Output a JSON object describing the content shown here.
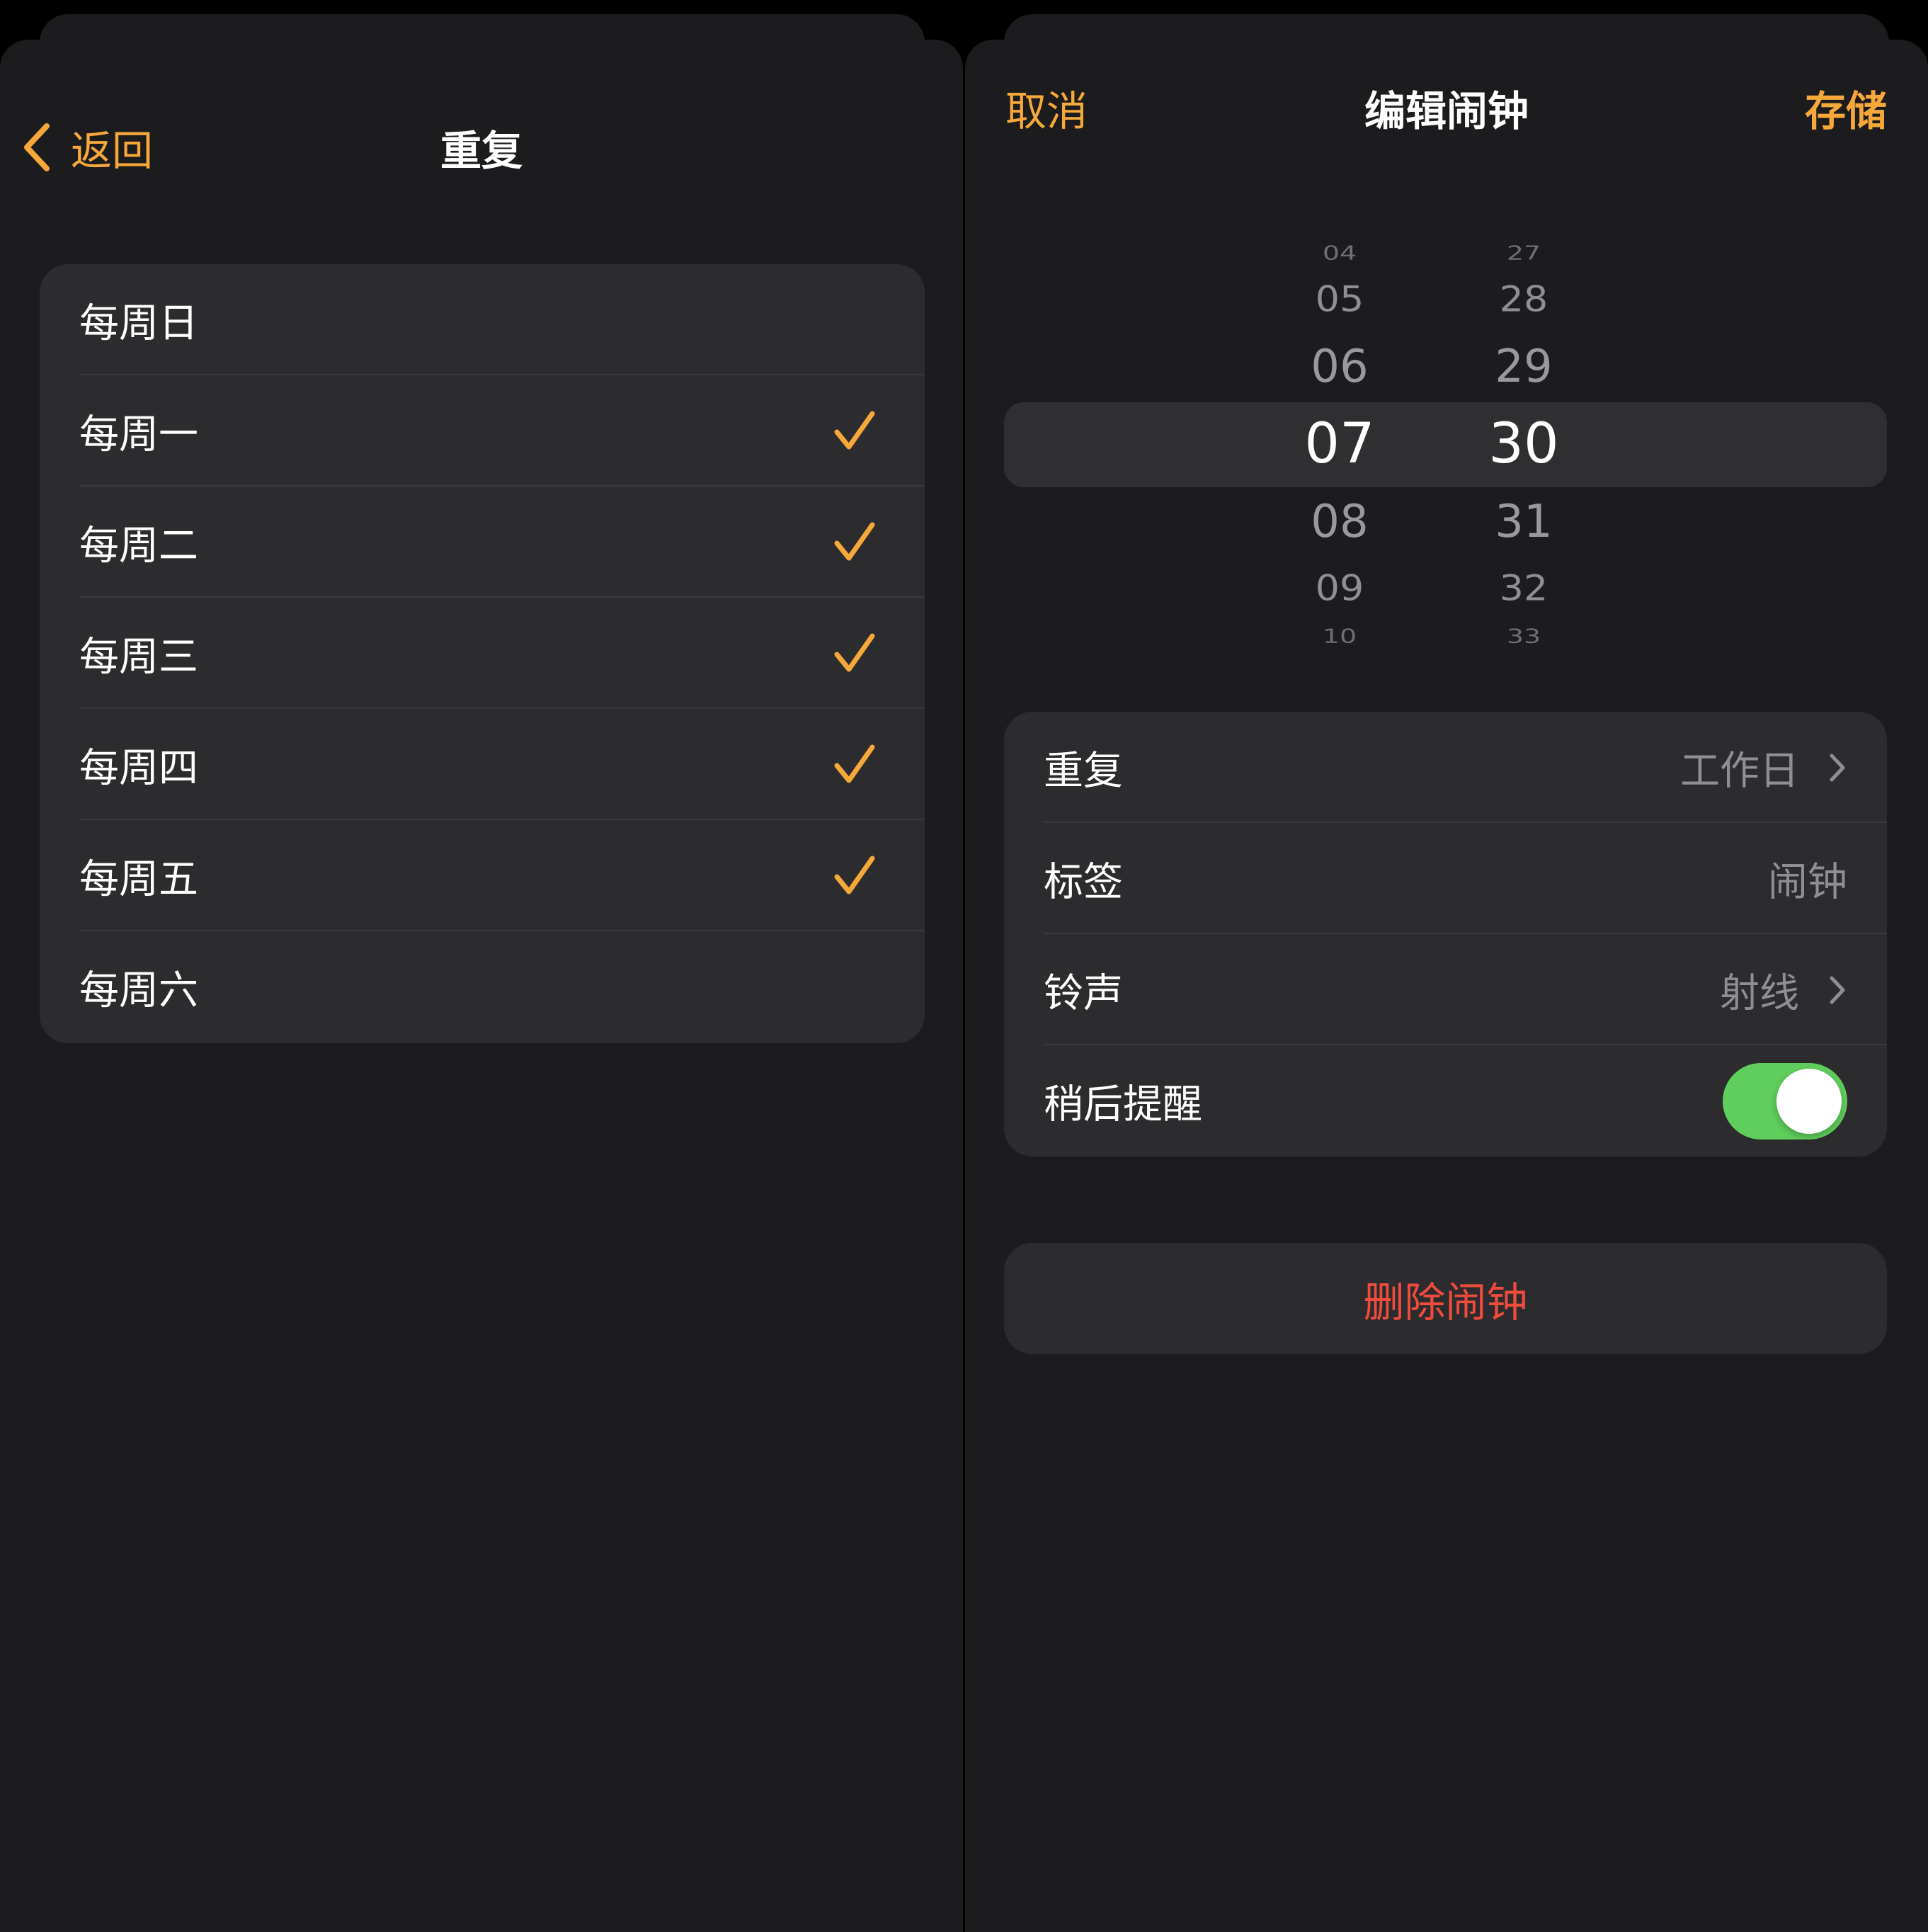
{
  "colors": {
    "accent": "#f6a83b",
    "destructive": "#f04b3c",
    "toggle_on": "#5fce5c",
    "secondary_text": "#8e8e93"
  },
  "left_panel": {
    "back_label": "返回",
    "title": "重复",
    "days": [
      {
        "label": "每周日",
        "checked": false
      },
      {
        "label": "每周一",
        "checked": true
      },
      {
        "label": "每周二",
        "checked": true
      },
      {
        "label": "每周三",
        "checked": true
      },
      {
        "label": "每周四",
        "checked": true
      },
      {
        "label": "每周五",
        "checked": true
      },
      {
        "label": "每周六",
        "checked": false
      }
    ]
  },
  "right_panel": {
    "cancel_label": "取消",
    "title": "编辑闹钟",
    "save_label": "存储",
    "picker": {
      "hours": [
        "04",
        "05",
        "06",
        "07",
        "08",
        "09",
        "10"
      ],
      "minutes": [
        "27",
        "28",
        "29",
        "30",
        "31",
        "32",
        "33"
      ],
      "selected_hour": "07",
      "selected_minute": "30"
    },
    "settings": {
      "repeat": {
        "label": "重复",
        "value": "工作日"
      },
      "tag": {
        "label": "标签",
        "value": "闹钟"
      },
      "ringtone": {
        "label": "铃声",
        "value": "射线"
      },
      "snooze": {
        "label": "稍后提醒",
        "on": true
      }
    },
    "delete_label": "删除闹钟"
  }
}
